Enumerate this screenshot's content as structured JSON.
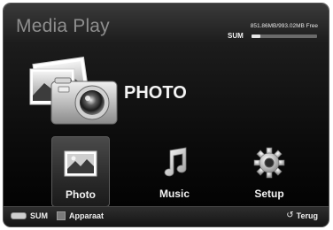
{
  "header": {
    "title": "Media Play",
    "storage_text": "851.86MB/993.02MB Free",
    "device_label": "SUM",
    "storage_used_fraction": 0.14
  },
  "hero": {
    "label": "PHOTO",
    "icon": "camera-photos-icon"
  },
  "menu": {
    "items": [
      {
        "label": "Photo",
        "icon": "photo-icon",
        "selected": true
      },
      {
        "label": "Music",
        "icon": "music-note-icon",
        "selected": false
      },
      {
        "label": "Setup",
        "icon": "gear-icon",
        "selected": false
      }
    ]
  },
  "footer": {
    "device_key_label": "SUM",
    "apparaat_label": "Apparaat",
    "return_label": "Terug",
    "return_icon": "return-icon"
  }
}
